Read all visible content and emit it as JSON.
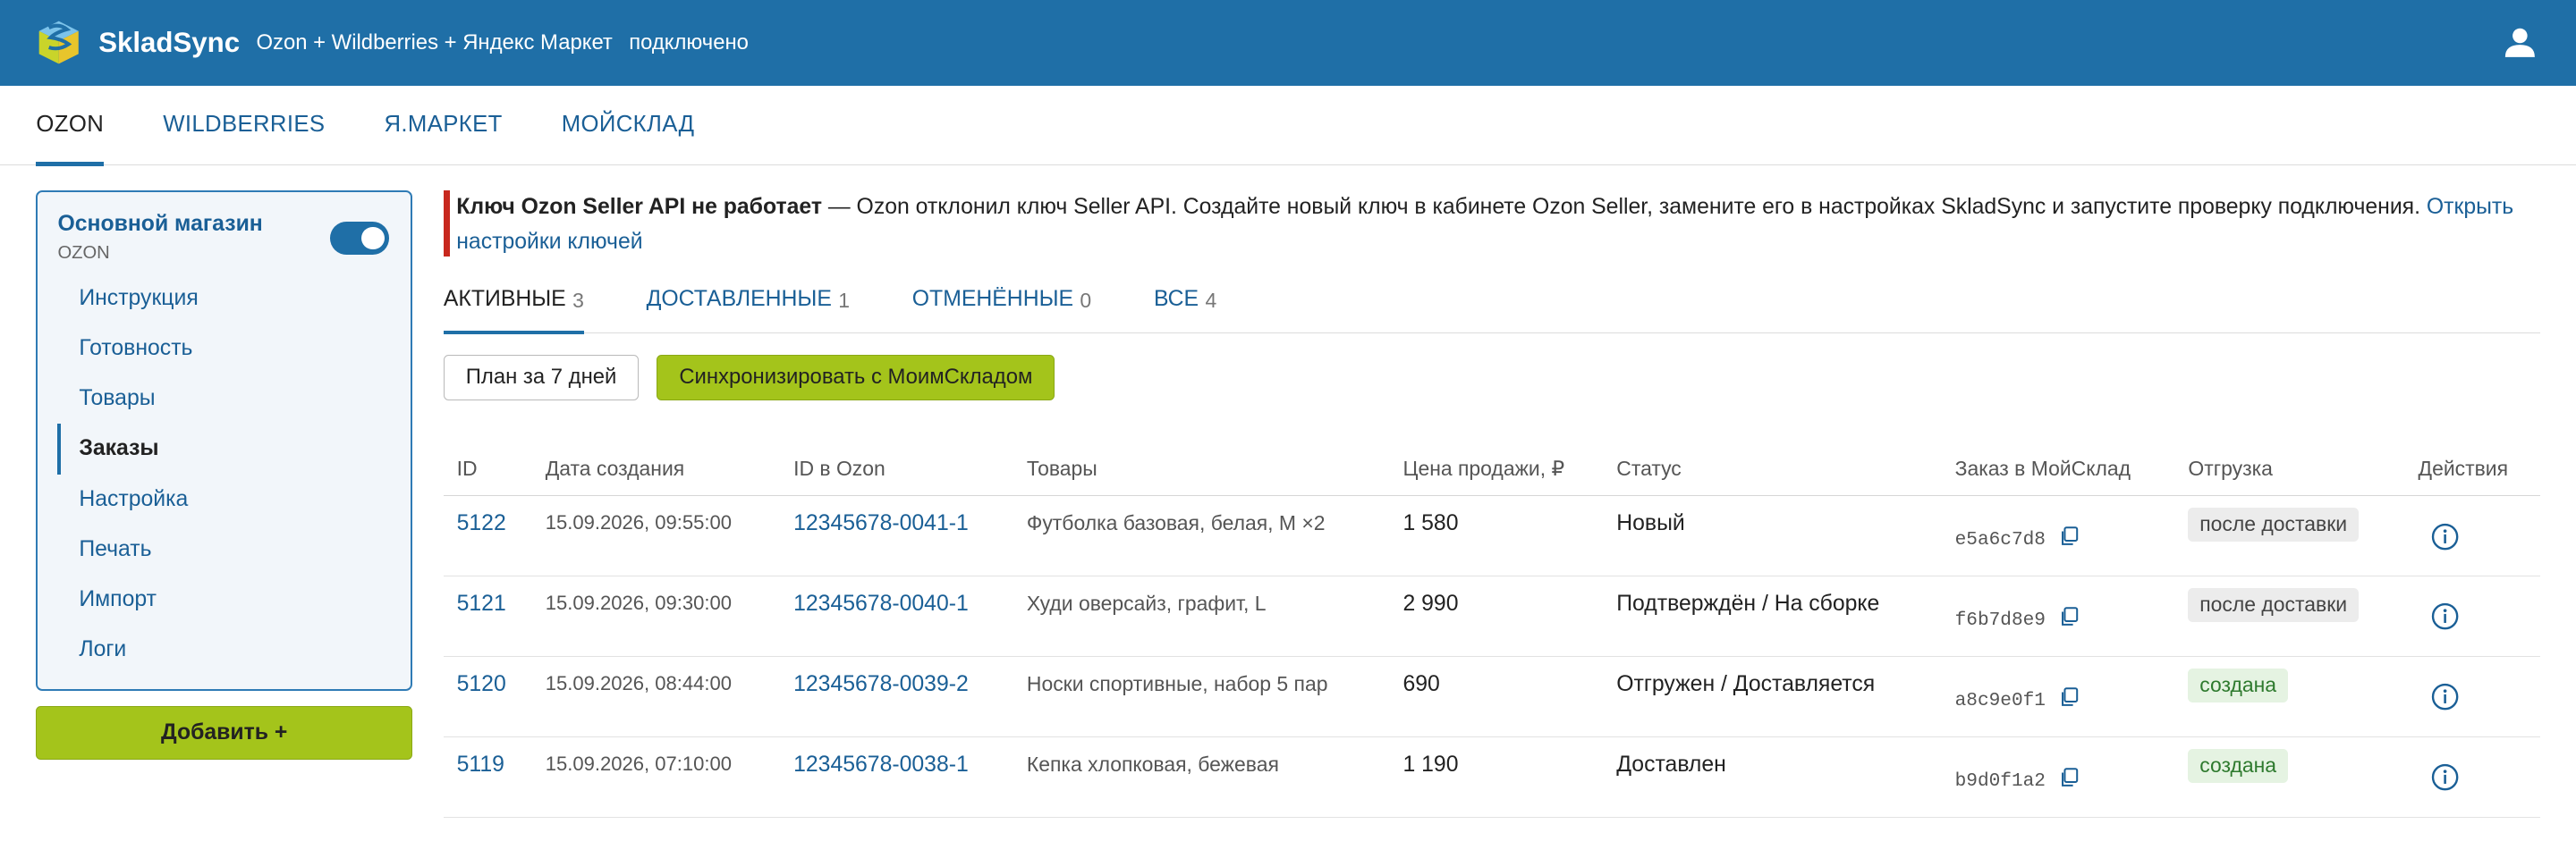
{
  "header": {
    "brand": "SkladSync",
    "subtitle": "Ozon + Wildberries + Яндекс Маркет",
    "status": "подключено",
    "icons": [
      "logo-icon",
      "user-icon"
    ],
    "color": "#1f6fa7"
  },
  "marketplace_tabs": [
    {
      "label": "OZON",
      "active": true
    },
    {
      "label": "WILDBERRIES",
      "active": false
    },
    {
      "label": "Я.МАРКЕТ",
      "active": false
    },
    {
      "label": "МОЙСКЛАД",
      "active": false
    }
  ],
  "sidebar": {
    "shop_name": "Основной магазин",
    "shop_marketplace": "OZON",
    "shop_enabled": true,
    "items": [
      {
        "label": "Инструкция",
        "active": false
      },
      {
        "label": "Готовность",
        "active": false
      },
      {
        "label": "Товары",
        "active": false
      },
      {
        "label": "Заказы",
        "active": true
      },
      {
        "label": "Настройка",
        "active": false
      },
      {
        "label": "Печать",
        "active": false
      },
      {
        "label": "Импорт",
        "active": false
      },
      {
        "label": "Логи",
        "active": false
      }
    ],
    "add_button": "Добавить +"
  },
  "alert": {
    "title": "Ключ Ozon Seller API не работает",
    "message": " — Ozon отклонил ключ Seller API. Создайте новый ключ в кабинете Ozon Seller, замените его в настройках SkladSync и запустите проверку подключения. ",
    "link": "Открыть настройки ключей",
    "color": "#c8281e"
  },
  "order_tabs": [
    {
      "label": "АКТИВНЫЕ",
      "count": "3",
      "active": true
    },
    {
      "label": "ДОСТАВЛЕННЫЕ",
      "count": "1",
      "active": false
    },
    {
      "label": "ОТМЕНЁННЫЕ",
      "count": "0",
      "active": false
    },
    {
      "label": "ВСЕ",
      "count": "4",
      "active": false
    }
  ],
  "buttons": {
    "plan": "План за 7 дней",
    "sync": "Синхронизировать с МоимСкладом"
  },
  "table": {
    "columns": [
      "ID",
      "Дата создания",
      "ID в Ozon",
      "Товары",
      "Цена продажи, ₽",
      "Статус",
      "Заказ в МойСклад",
      "Отгрузка",
      "Действия"
    ],
    "rows": [
      {
        "id": "5122",
        "date": "15.09.2026, 09:55:00",
        "ozon_id": "12345678-0041-1",
        "goods": "Футболка базовая, белая, M ×2",
        "price": "1 580",
        "status": "Новый",
        "ms_order": "e5a6c7d8",
        "shipment": "после доставки",
        "shipment_kind": "grey"
      },
      {
        "id": "5121",
        "date": "15.09.2026, 09:30:00",
        "ozon_id": "12345678-0040-1",
        "goods": "Худи оверсайз, графит, L",
        "price": "2 990",
        "status": "Подтверждён / На сборке",
        "ms_order": "f6b7d8e9",
        "shipment": "после доставки",
        "shipment_kind": "grey"
      },
      {
        "id": "5120",
        "date": "15.09.2026, 08:44:00",
        "ozon_id": "12345678-0039-2",
        "goods": "Носки спортивные, набор 5 пар",
        "price": "690",
        "status": "Отгружен / Доставляется",
        "ms_order": "a8c9e0f1",
        "shipment": "создана",
        "shipment_kind": "green"
      },
      {
        "id": "5119",
        "date": "15.09.2026, 07:10:00",
        "ozon_id": "12345678-0038-1",
        "goods": "Кепка хлопковая, бежевая",
        "price": "1 190",
        "status": "Доставлен",
        "ms_order": "b9d0f1a2",
        "shipment": "создана",
        "shipment_kind": "green"
      }
    ],
    "row_icons": [
      "copy-icon",
      "info-icon"
    ]
  }
}
